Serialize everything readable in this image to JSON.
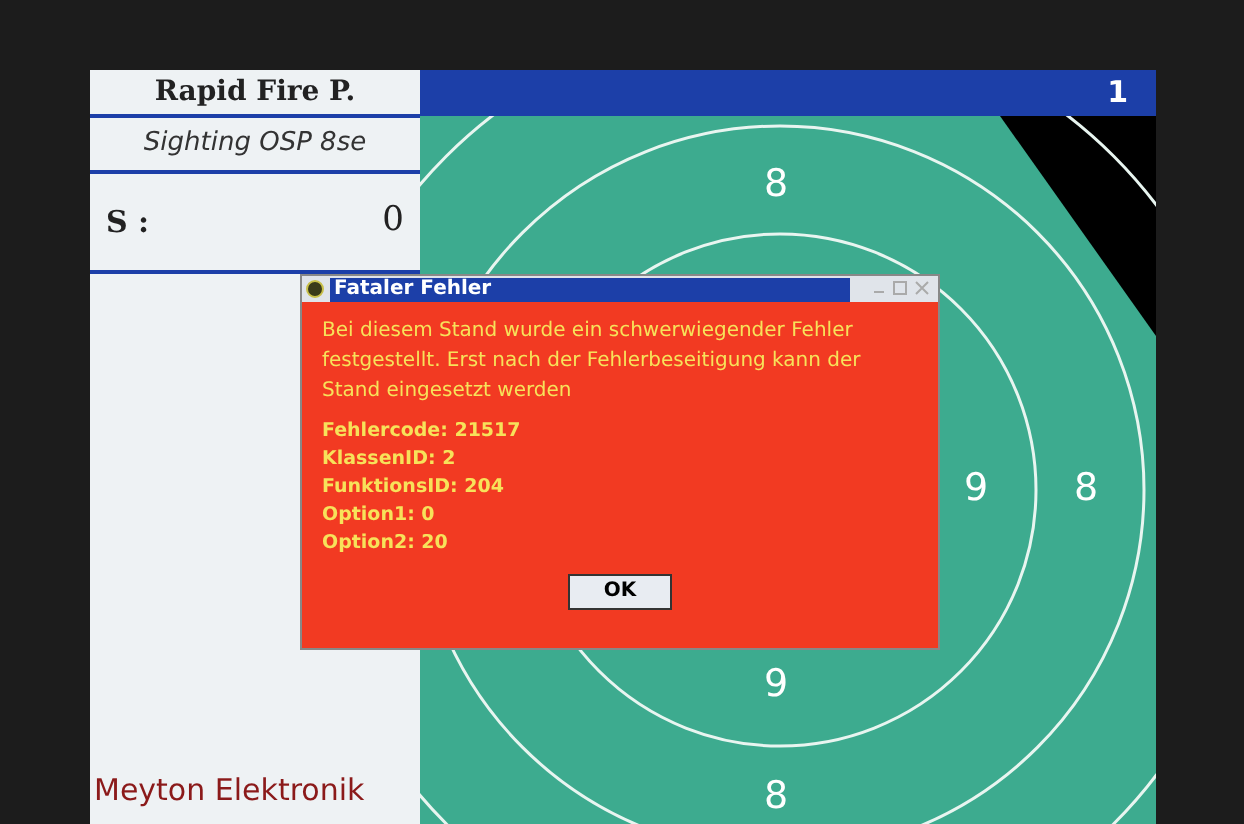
{
  "left_panel": {
    "discipline": "Rapid Fire P.",
    "mode": "Sighting OSP 8se",
    "score_label": "S :",
    "score_value": "0",
    "footer": "Meyton Elektronik"
  },
  "top_bar": {
    "number": "1"
  },
  "target": {
    "ring_labels": [
      "8",
      "9",
      "8",
      "9",
      "8"
    ]
  },
  "dialog": {
    "title": "Fataler Fehler",
    "message": "Bei diesem Stand wurde ein schwerwiegender Fehler festgestellt. Erst nach der Fehlerbeseitigung kann der Stand eingesetzt werden",
    "details": [
      "Fehlercode: 21517",
      "KlassenID: 2",
      "FunktionsID: 204",
      "Option1: 0",
      "Option2: 20"
    ],
    "button": "OK"
  }
}
